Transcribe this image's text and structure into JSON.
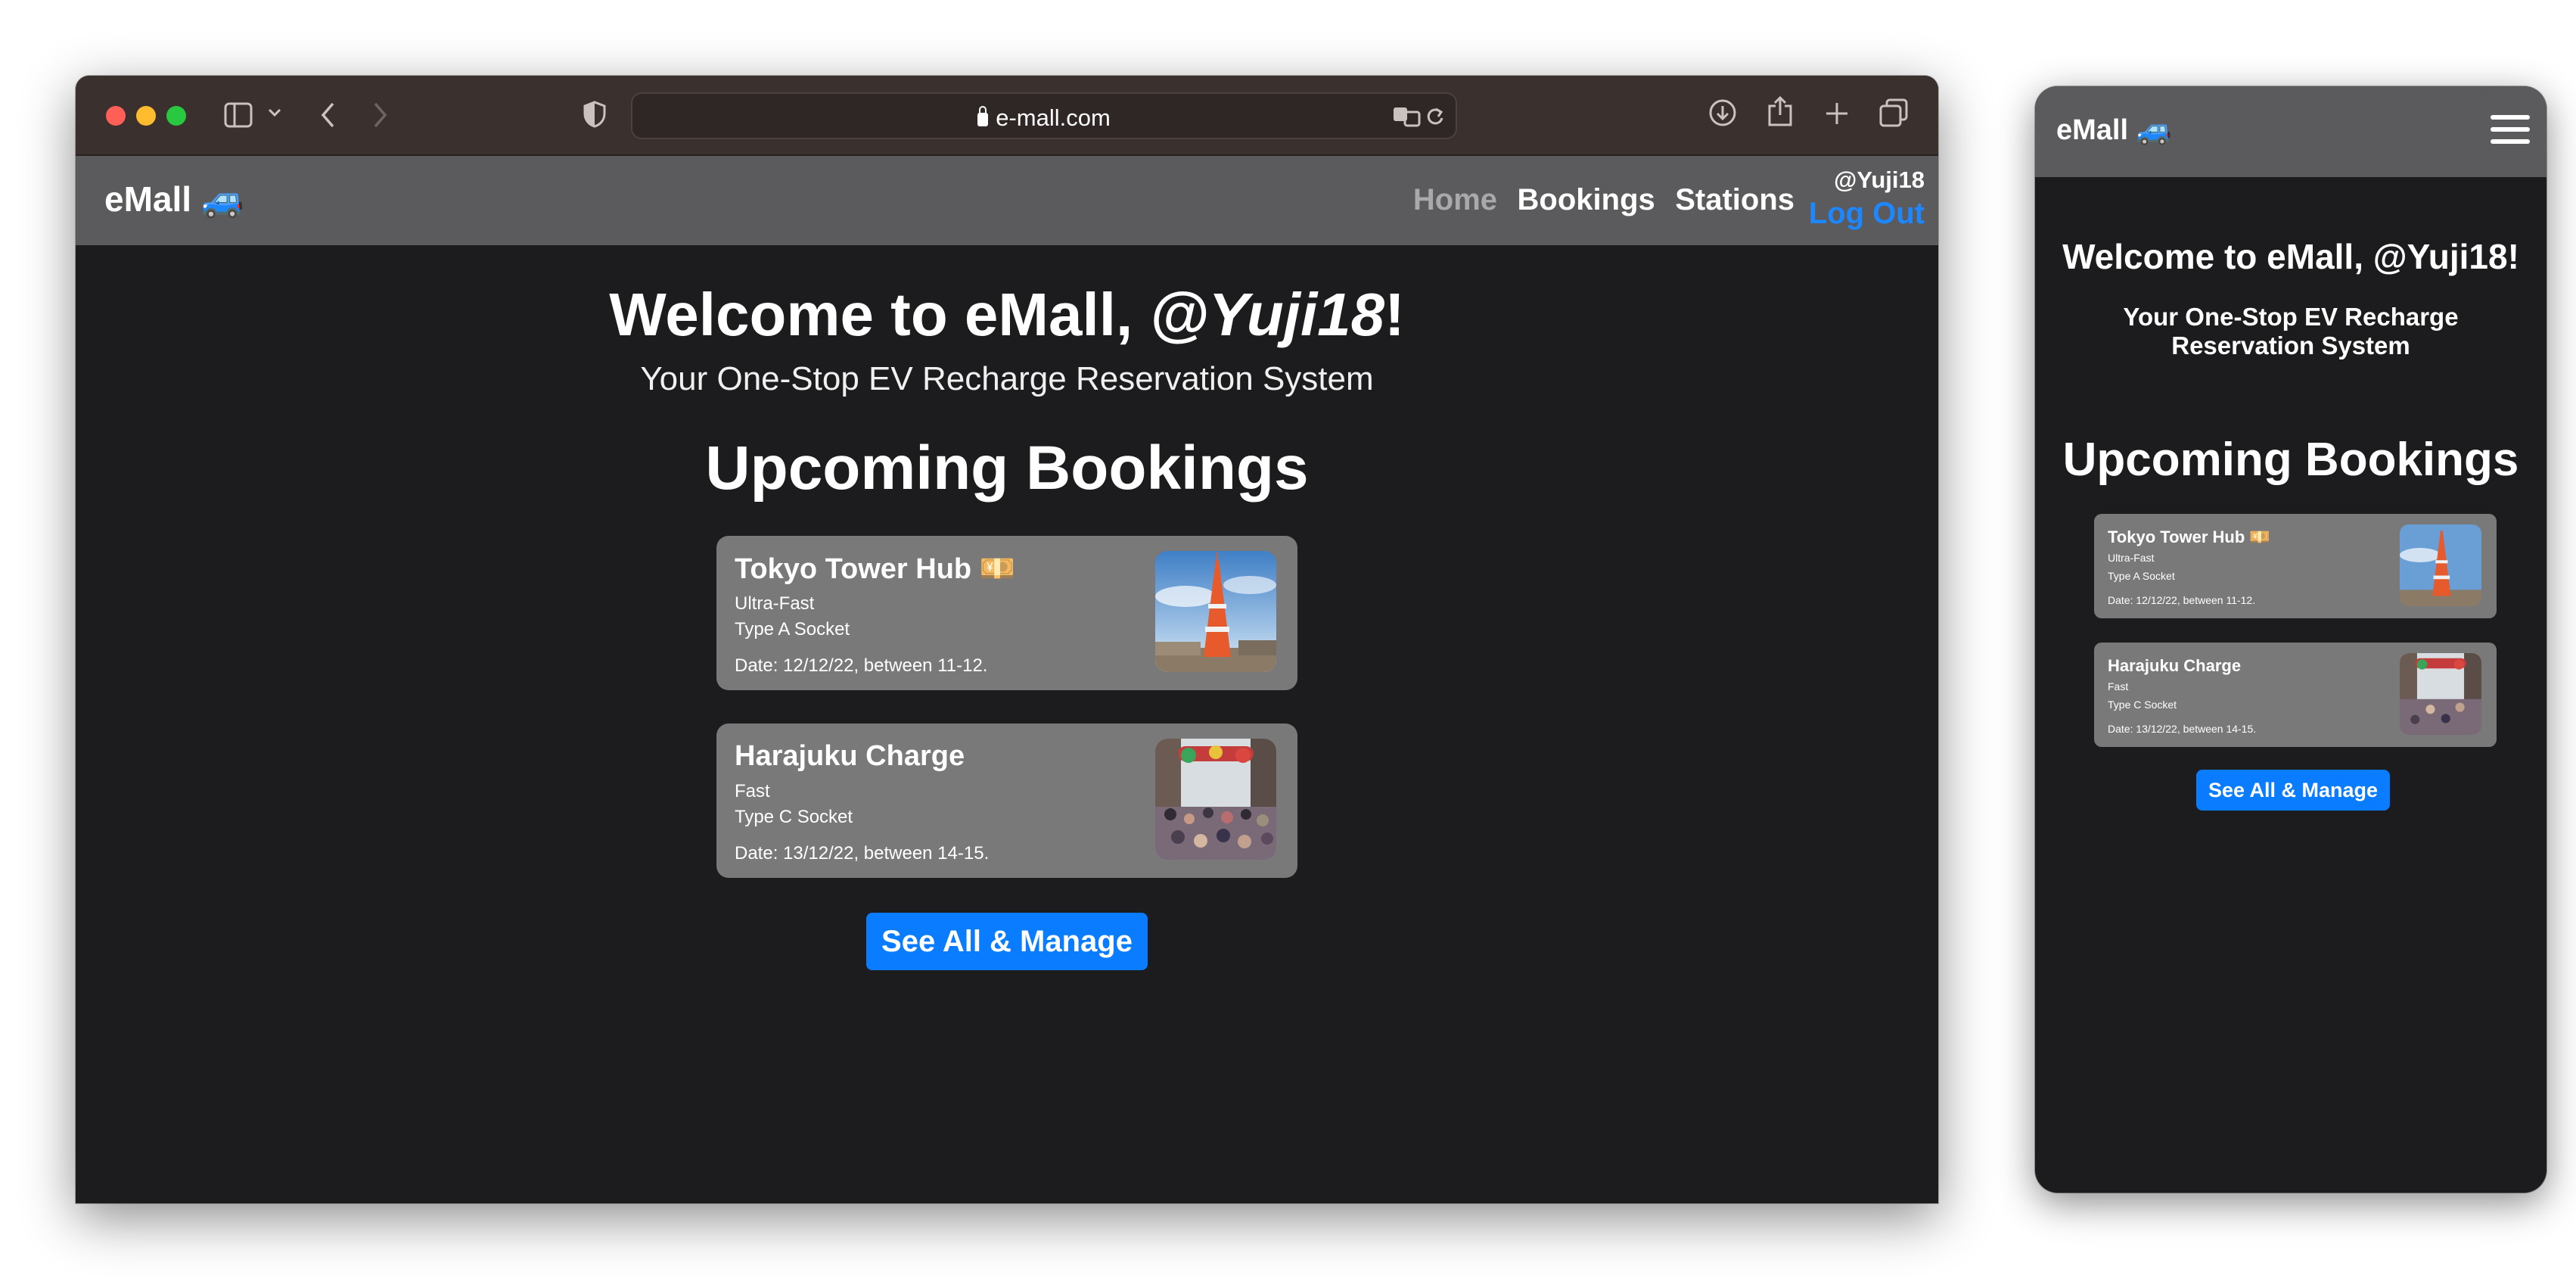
{
  "browser": {
    "url": "e-mall.com"
  },
  "app": {
    "brand": "eMall 🚙",
    "nav": {
      "home": "Home",
      "bookings": "Bookings",
      "stations": "Stations"
    },
    "user_handle": "@Yuji18",
    "logout": "Log Out"
  },
  "main": {
    "welcome_prefix": "Welcome to eMall, ",
    "welcome_handle": "@Yuji18",
    "welcome_suffix": "!",
    "welcome_mobile": "Welcome to eMall, @Yuji18!",
    "subtitle": "Your One-Stop EV Recharge Reservation System",
    "section_title": "Upcoming Bookings",
    "bookings": [
      {
        "title": "Tokyo Tower Hub 💴",
        "speed": "Ultra-Fast",
        "socket": "Type A Socket",
        "date": "Date: 12/12/22, between 11-12."
      },
      {
        "title": "Harajuku Charge",
        "speed": "Fast",
        "socket": "Type C Socket",
        "date": "Date: 13/12/22, between 14-15."
      }
    ],
    "cta": "See All & Manage"
  },
  "colors": {
    "accent": "#0a7cff",
    "page_bg": "#1c1c1e",
    "nav_bg": "#5b5b5d",
    "card_bg": "#797979"
  }
}
